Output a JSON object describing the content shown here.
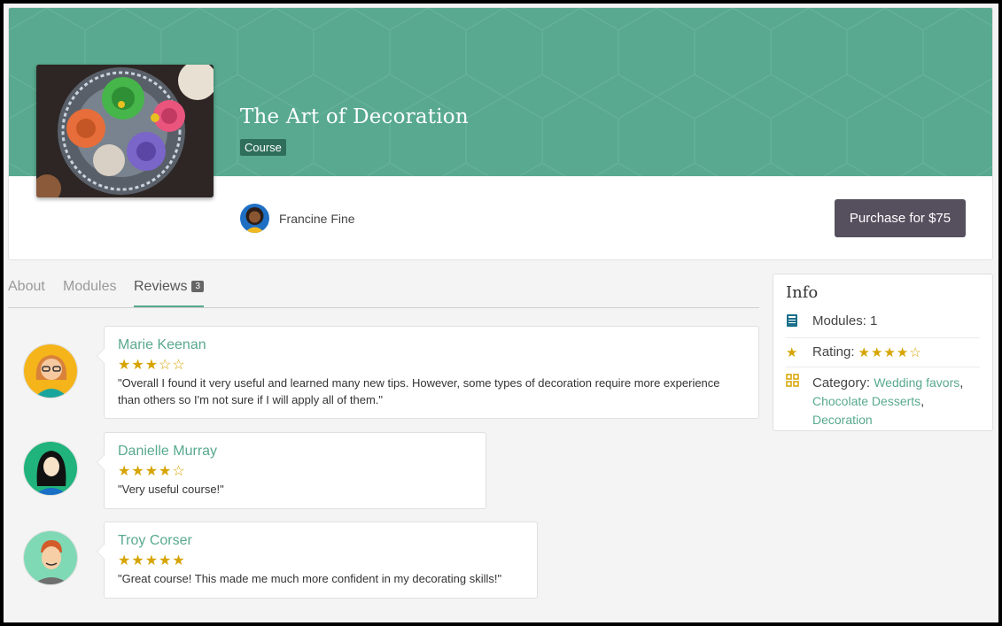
{
  "course": {
    "title": "The Art of Decoration",
    "type": "Course",
    "author": "Francine Fine",
    "purchase_label": "Purchase for $75"
  },
  "tabs": {
    "about": "About",
    "modules": "Modules",
    "reviews": "Reviews",
    "reviews_count": "3"
  },
  "reviews": [
    {
      "name": "Marie Keenan",
      "stars": "★★★☆☆",
      "text": "\"Overall I found it very useful and learned many new tips. However, some types of decoration require more experience than others so I'm not sure if I will apply all of them.\""
    },
    {
      "name": "Danielle Murray",
      "stars": "★★★★☆",
      "text": "\"Very useful course!\""
    },
    {
      "name": "Troy Corser",
      "stars": "★★★★★",
      "text": "\"Great course! This made me much more confident in my decorating skills!\""
    }
  ],
  "info": {
    "title": "Info",
    "modules": "Modules: 1",
    "rating_label": "Rating:",
    "rating_stars": "★★★★☆",
    "category_label": "Category:",
    "categories": [
      "Wedding favors",
      "Chocolate Desserts",
      "Decoration"
    ]
  },
  "colors": {
    "accent": "#58a98f",
    "star": "#d6a400",
    "button": "#564f5e"
  }
}
